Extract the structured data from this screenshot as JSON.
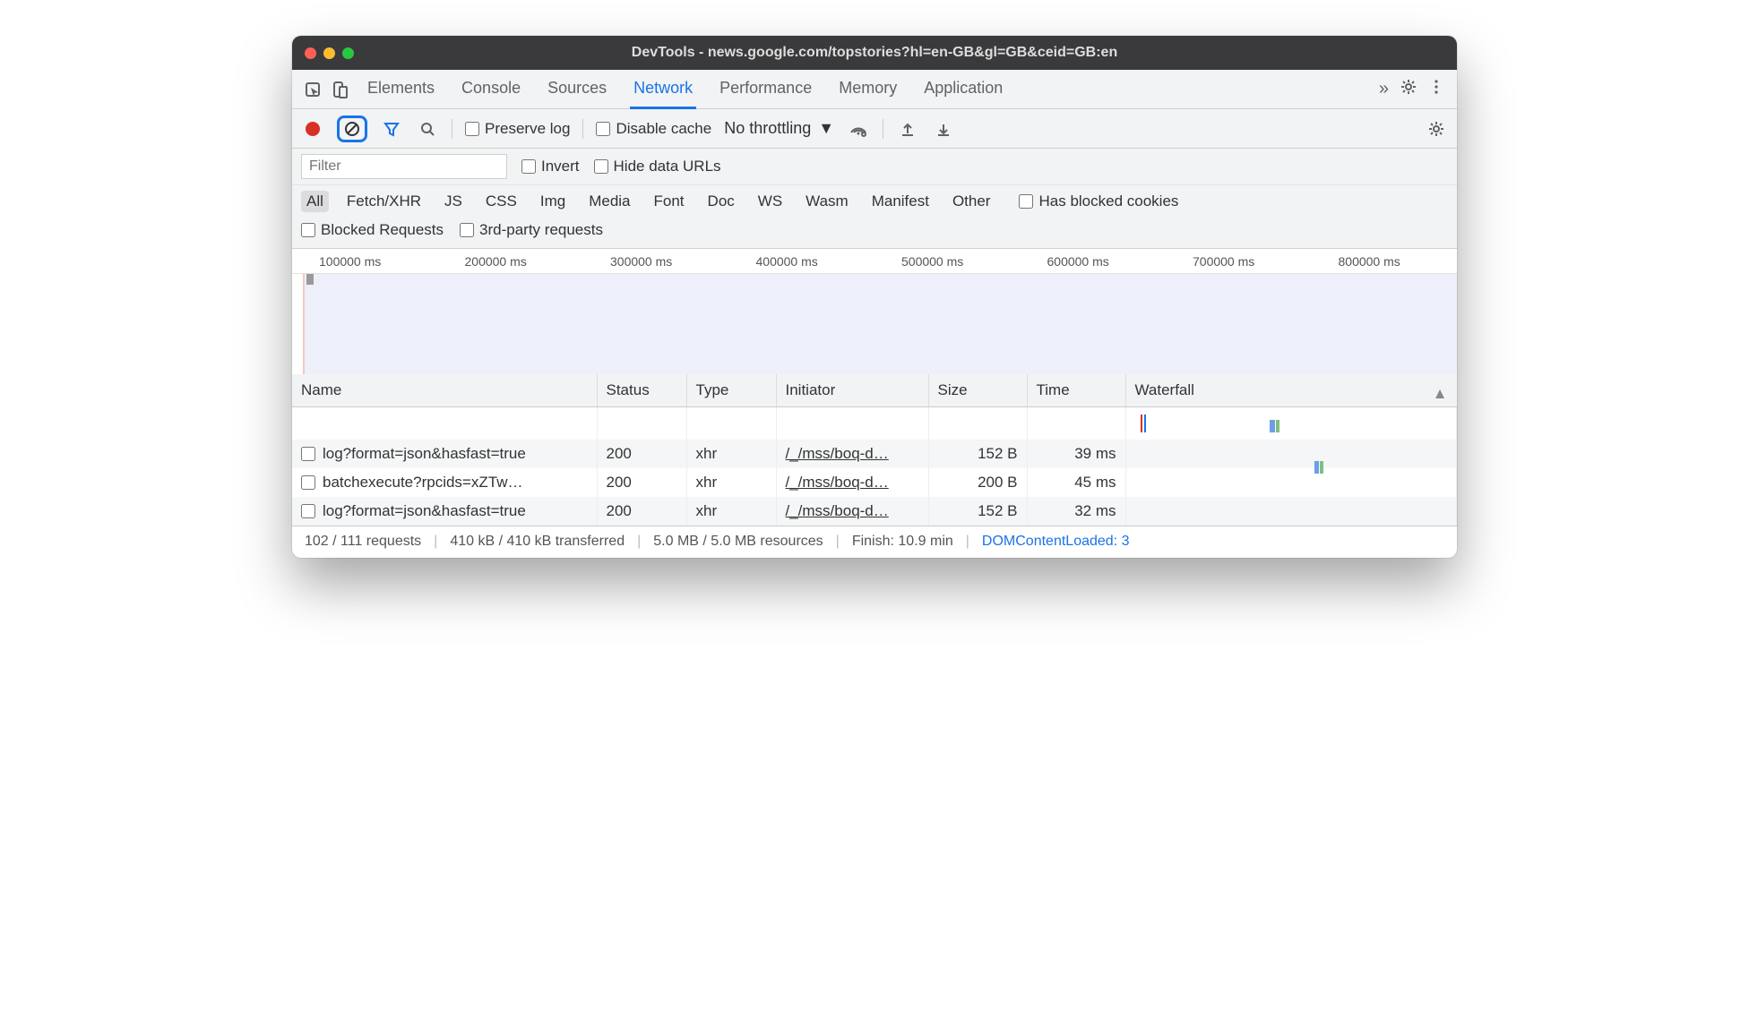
{
  "window": {
    "title": "DevTools - news.google.com/topstories?hl=en-GB&gl=GB&ceid=GB:en"
  },
  "tabs": {
    "items": [
      "Elements",
      "Console",
      "Sources",
      "Network",
      "Performance",
      "Memory",
      "Application"
    ],
    "active": "Network",
    "more_glyph": "»"
  },
  "toolbar": {
    "preserve_log": "Preserve log",
    "disable_cache": "Disable cache",
    "throttling": "No throttling"
  },
  "filter": {
    "placeholder": "Filter",
    "invert": "Invert",
    "hide_data_urls": "Hide data URLs"
  },
  "type_filters": [
    "All",
    "Fetch/XHR",
    "JS",
    "CSS",
    "Img",
    "Media",
    "Font",
    "Doc",
    "WS",
    "Wasm",
    "Manifest",
    "Other"
  ],
  "type_filters_active": "All",
  "extra_filters": {
    "has_blocked_cookies": "Has blocked cookies",
    "blocked_requests": "Blocked Requests",
    "third_party": "3rd-party requests"
  },
  "timeline": {
    "ticks": [
      "100000 ms",
      "200000 ms",
      "300000 ms",
      "400000 ms",
      "500000 ms",
      "600000 ms",
      "700000 ms",
      "800000 ms"
    ]
  },
  "table": {
    "columns": [
      "Name",
      "Status",
      "Type",
      "Initiator",
      "Size",
      "Time",
      "Waterfall"
    ],
    "rows": [
      {
        "name": "log?format=json&hasfast=true",
        "status": "200",
        "type": "xhr",
        "initiator": "/_/mss/boq-d…",
        "size": "152 B",
        "time": "39 ms"
      },
      {
        "name": "batchexecute?rpcids=xZTw…",
        "status": "200",
        "type": "xhr",
        "initiator": "/_/mss/boq-d…",
        "size": "200 B",
        "time": "45 ms"
      },
      {
        "name": "log?format=json&hasfast=true",
        "status": "200",
        "type": "xhr",
        "initiator": "/_/mss/boq-d…",
        "size": "152 B",
        "time": "32 ms"
      }
    ]
  },
  "status": {
    "requests": "102 / 111 requests",
    "transferred": "410 kB / 410 kB transferred",
    "resources": "5.0 MB / 5.0 MB resources",
    "finish": "Finish: 10.9 min",
    "dcl": "DOMContentLoaded: 3"
  }
}
